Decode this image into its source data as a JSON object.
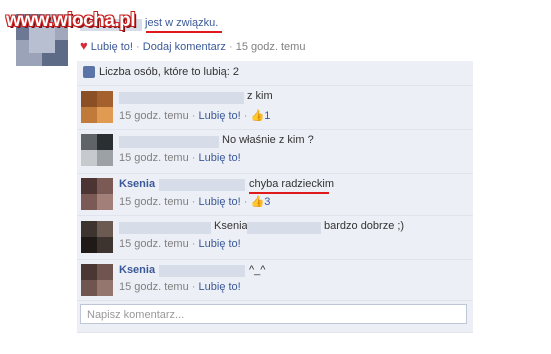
{
  "watermark": {
    "text": "www.wiocha.pl"
  },
  "post": {
    "text_partial": "jest w związku.",
    "like_label": "Lubię to!",
    "comment_label": "Dodaj komentarz",
    "time": "15 godz. temu"
  },
  "likes": {
    "text": "Liczba osób, które to lubią: 2"
  },
  "comments": [
    {
      "name": "",
      "text": "z kim",
      "time": "15 godz. temu",
      "like_label": "Lubię to!",
      "like_count": "1"
    },
    {
      "name": "",
      "text": "No właśnie z kim ?",
      "time": "15 godz. temu",
      "like_label": "Lubię to!",
      "like_count": ""
    },
    {
      "name": "Ksenia",
      "text": "chyba radzieckim",
      "time": "15 godz. temu",
      "like_label": "Lubię to!",
      "like_count": "3"
    },
    {
      "name": "",
      "text_mid": "Ksenia",
      "text": "bardzo dobrze ;)",
      "time": "15 godz. temu",
      "like_label": "Lubię to!",
      "like_count": ""
    },
    {
      "name": "Ksenia",
      "text": "^_^",
      "time": "15 godz. temu",
      "like_label": "Lubię to!",
      "like_count": ""
    }
  ],
  "comment_input": {
    "placeholder": "Napisz komentarz..."
  },
  "colors": {
    "link": "#3b5998",
    "panel": "#eceff5",
    "highlight": "#e0191c"
  },
  "icons": {
    "like": "thumbs-up-icon",
    "heart": "heart-icon"
  }
}
